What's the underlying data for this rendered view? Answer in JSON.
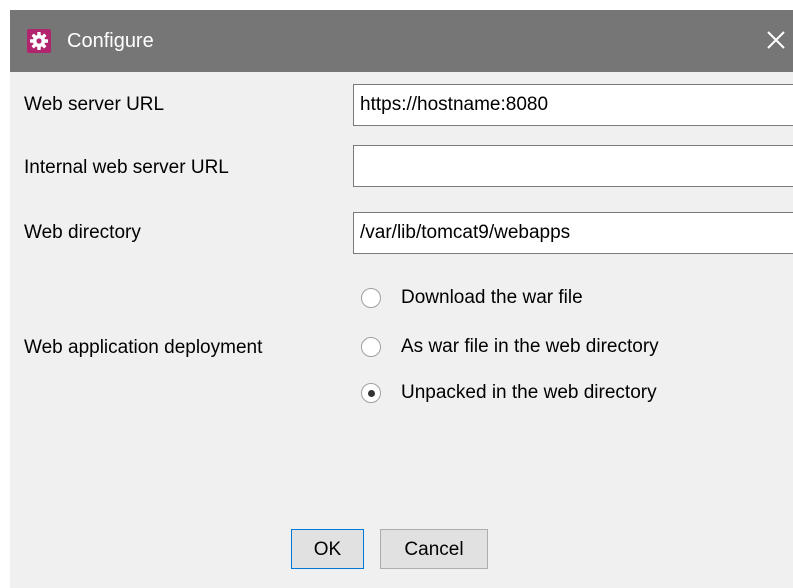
{
  "window": {
    "title": "Configure",
    "icon": "gear-icon",
    "accent_color": "#b0256e"
  },
  "form": {
    "web_server_url": {
      "label": "Web server URL",
      "value": "https://hostname:8080"
    },
    "internal_web_server_url": {
      "label": "Internal web server URL",
      "value": ""
    },
    "web_directory": {
      "label": "Web directory",
      "value": "/var/lib/tomcat9/webapps"
    },
    "deployment": {
      "label": "Web application deployment",
      "options": [
        {
          "label": "Download the war file",
          "selected": false
        },
        {
          "label": "As war file in the web directory",
          "selected": false
        },
        {
          "label": "Unpacked in the web directory",
          "selected": true
        }
      ]
    }
  },
  "buttons": {
    "ok_label": "OK",
    "cancel_label": "Cancel"
  }
}
